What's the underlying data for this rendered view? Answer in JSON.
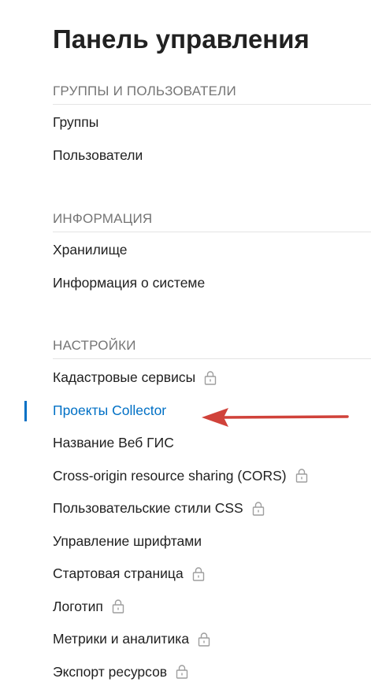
{
  "page": {
    "title": "Панель управления"
  },
  "sections": [
    {
      "title": "ГРУППЫ И ПОЛЬЗОВАТЕЛИ",
      "items": [
        {
          "label": "Группы",
          "locked": false
        },
        {
          "label": "Пользователи",
          "locked": false
        }
      ]
    },
    {
      "title": "ИНФОРМАЦИЯ",
      "items": [
        {
          "label": "Хранилище",
          "locked": false
        },
        {
          "label": "Информация о системе",
          "locked": false
        }
      ]
    },
    {
      "title": "НАСТРОЙКИ",
      "items": [
        {
          "label": "Кадастровые сервисы",
          "locked": true
        },
        {
          "label": "Проекты Collector",
          "locked": false,
          "selected": true
        },
        {
          "label": "Название Веб ГИС",
          "locked": false
        },
        {
          "label": "Cross-origin resource sharing (CORS)",
          "locked": true
        },
        {
          "label": "Пользовательские стили CSS",
          "locked": true
        },
        {
          "label": "Управление шрифтами",
          "locked": false
        },
        {
          "label": "Стартовая страница",
          "locked": true
        },
        {
          "label": "Логотип",
          "locked": true
        },
        {
          "label": "Метрики и аналитика",
          "locked": true
        },
        {
          "label": "Экспорт ресурсов",
          "locked": true
        }
      ]
    }
  ],
  "icons": {
    "locked_item_icon": "lock-icon",
    "annotation": "red-arrow-icon"
  },
  "colors": {
    "accent": "#0070c5",
    "annotation_arrow": "#d0423a",
    "section_title": "#757575",
    "text": "#212121",
    "lock": "#9e9e9e"
  }
}
